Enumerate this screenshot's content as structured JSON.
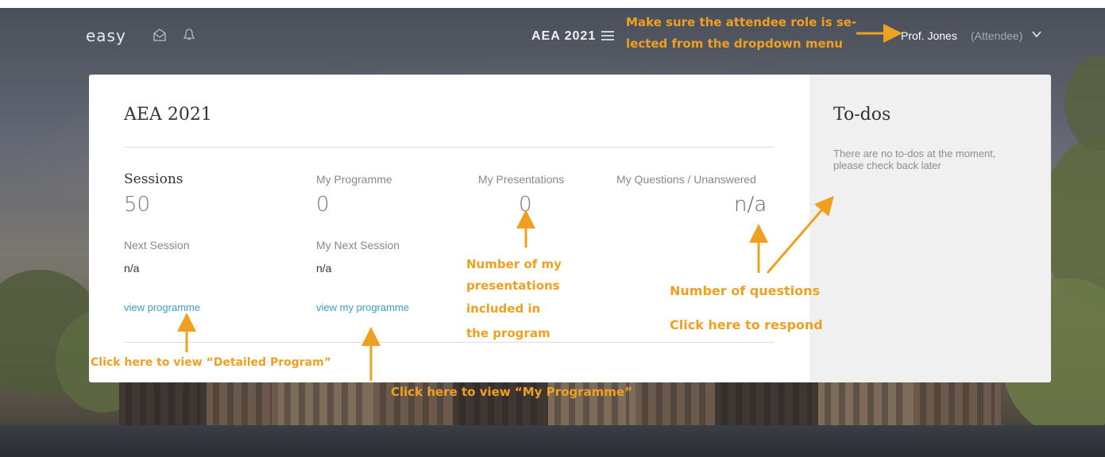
{
  "header": {
    "logo": "easy",
    "icons": [
      "mail-icon",
      "bell-icon",
      "menu-icon",
      "chevron-down-icon"
    ],
    "conference": "AEA 2021",
    "user_name": "Prof. Jones",
    "user_role": "(Attendee)"
  },
  "card": {
    "title": "AEA 2021",
    "stats": {
      "sessions_label": "Sessions",
      "sessions_value": "50",
      "my_programme_label": "My Programme",
      "my_programme_value": "0",
      "my_presentations_label": "My Presentations",
      "my_presentations_value": "0",
      "my_questions_label": "My Questions / Unanswered",
      "my_questions_value": "n/a"
    },
    "next_session_label": "Next Session",
    "next_session_value": "n/a",
    "my_next_session_label": "My Next Session",
    "my_next_session_value": "n/a",
    "view_programme": "view programme",
    "view_my_programme": "view my programme"
  },
  "todos": {
    "title": "To-dos",
    "empty_text": "There are no to-dos at the moment, please check back later"
  },
  "annotations": {
    "role_note_line1": "Make sure the attendee role is se-",
    "role_note_line2": "lected from the dropdown menu",
    "presentations_note": [
      "Number of my",
      "presentations",
      "included in",
      "the program"
    ],
    "questions_note": "Number of questions",
    "respond_note": "Click here to respond",
    "detailed_program_note": "Click here to view “Detailed Program”",
    "my_programme_note": "Click here to view “My Programme”"
  },
  "colors": {
    "accent_link": "#3d9bd1",
    "annotation": "#f0a020"
  }
}
